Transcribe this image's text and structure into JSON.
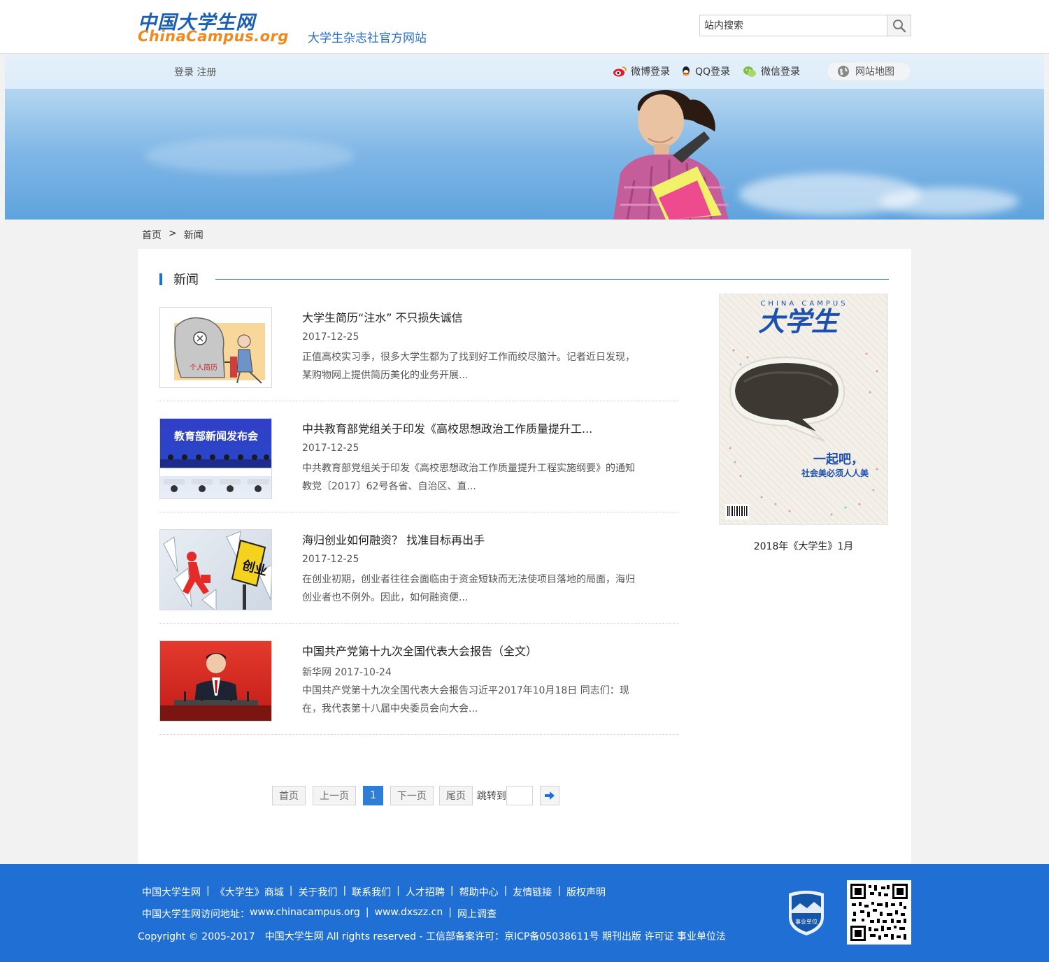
{
  "header": {
    "logo_cn": "中国大学生网",
    "logo_en": "ChinaCampus.org",
    "slogan": "大学生杂志社官方网站",
    "search_placeholder": "站内搜索"
  },
  "topbar": {
    "login": "登录",
    "register": "注册",
    "weibo_login": "微博登录",
    "qq_login": "QQ登录",
    "wechat_login": "微信登录",
    "sitemap": "网站地图"
  },
  "breadcrumb": {
    "home": "首页",
    "separator": ">",
    "current": "新闻"
  },
  "section": {
    "title": "新闻"
  },
  "news": [
    {
      "title": "大学生简历“注水” 不只损失诚信",
      "date": "2017-12-25",
      "summary": "正值高校实习季，很多大学生都为了找到好工作而绞尽脑汁。记者近日发现，某购物网上提供简历美化的业务开展...",
      "thumb_text": "个人简历"
    },
    {
      "title": "中共教育部党组关于印发《高校思想政治工作质量提升工...",
      "date": "2017-12-25",
      "summary": "中共教育部党组关于印发《高校思想政治工作质量提升工程实施纲要》的通知教党〔2017〕62号各省、自治区、直...",
      "thumb_text": "教育部新闻发布会"
    },
    {
      "title": "海归创业如何融资？ 找准目标再出手",
      "date": "2017-12-25",
      "summary": "在创业初期，创业者往往会面临由于资金短缺而无法使项目落地的局面，海归创业者也不例外。因此，如何融资便...",
      "thumb_text": "创业"
    },
    {
      "title": "中国共产党第十九次全国代表大会报告（全文）",
      "date": "新华网 2017-10-24",
      "summary": "中国共产党第十九次全国代表大会报告习近平2017年10月18日 同志们：现在，我代表第十八届中央委员会向大会...",
      "thumb_text": ""
    }
  ],
  "magazine": {
    "cover_en": "CHINA CAMPUS",
    "cover_title": "大学生",
    "cover_slogan_1": "一起吧，",
    "cover_slogan_2": "社会美必须人人美",
    "caption": "2018年《大学生》1月"
  },
  "pagination": {
    "first": "首页",
    "prev": "上一页",
    "current": "1",
    "next": "下一页",
    "last": "尾页",
    "jump": "跳转到"
  },
  "footer": {
    "links": [
      "中国大学生网",
      "《大学生》商城",
      "关于我们",
      "联系我们",
      "人才招聘",
      "帮助中心",
      "友情链接",
      "版权声明"
    ],
    "address_label": "中国大学生网访问地址：",
    "address_links": [
      "www.chinacampus.org",
      "www.dxszz.cn",
      "网上调查"
    ],
    "copyright": "Copyright © 2005-2017　中国大学生网 All rights reserved - 工信部备案许可：京ICP备05038611号 期刊出版 许可证 事业单位法",
    "badge_text": "事业单位"
  },
  "colors": {
    "brand_blue": "#1f6fd4",
    "logo_orange": "#f08a1c",
    "accent_blue": "#2d7fd6"
  }
}
